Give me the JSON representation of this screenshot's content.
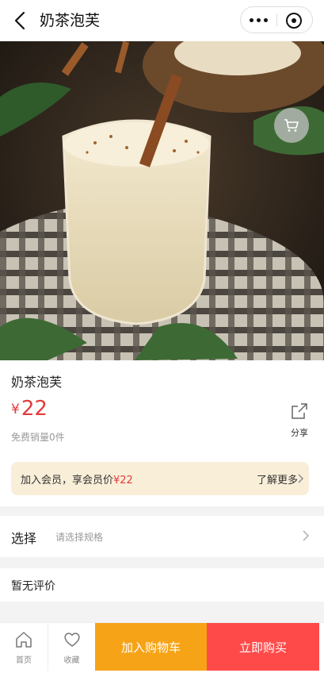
{
  "nav": {
    "title": "奶茶泡芙",
    "back_icon": "back-arrow-icon",
    "more_icon": "more-dots-icon",
    "close_icon": "mini-program-close-icon"
  },
  "product": {
    "name": "奶茶泡芙",
    "currency": "¥",
    "price": "22",
    "sales": "免费销量0件",
    "share_label": "分享"
  },
  "member": {
    "text": "加入会员，享会员价",
    "price": "¥22",
    "more": "了解更多"
  },
  "spec": {
    "label": "选择",
    "placeholder": "请选择规格"
  },
  "reviews": {
    "text": "暂无评价"
  },
  "tabbar": {
    "home_label": "首页",
    "fav_label": "收藏",
    "add_cart_label": "加入购物车",
    "buy_label": "立即购买"
  },
  "colors": {
    "price": "#e23b3b",
    "add_cart": "#f7a317",
    "buy": "#ff4a4a",
    "member_bg": "#f9eed8"
  }
}
